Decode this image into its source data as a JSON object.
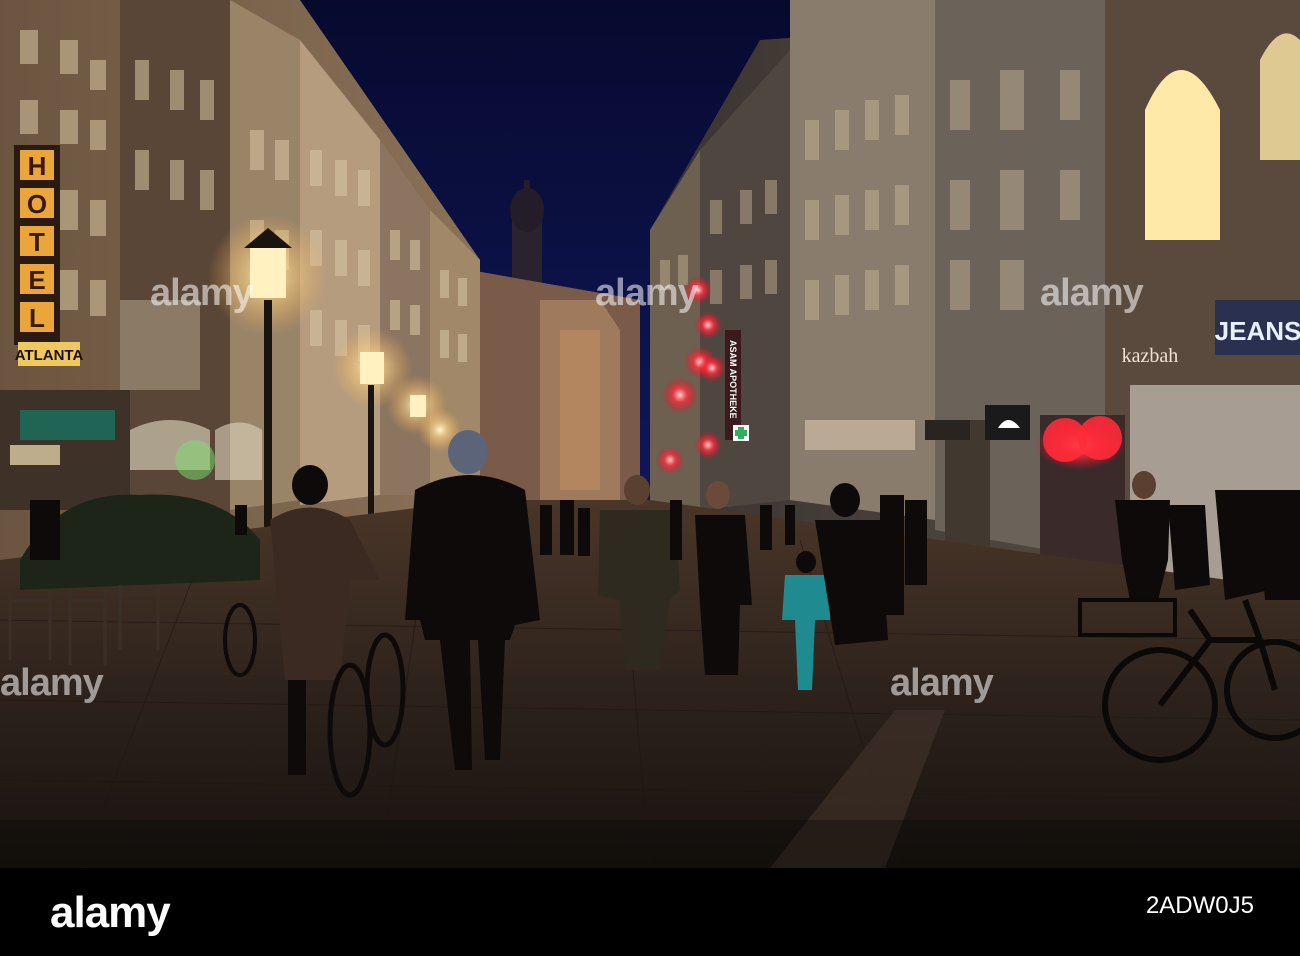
{
  "scene": {
    "description_icon": "night-street-photo",
    "signs": {
      "hotel_letters": [
        "H",
        "O",
        "T",
        "E",
        "L"
      ],
      "atlanta": "ATLANTA",
      "jeans": "JEANS",
      "kazbah": "kazbah",
      "apotheke": "ASAM APOTHEKE"
    }
  },
  "watermark": {
    "text": "alamy"
  },
  "footer": {
    "logo": "alamy",
    "image_id": "2ADW0J5"
  },
  "colors": {
    "sky": "#0a1240",
    "street": "#2a1f1a",
    "lamp": "#fff2c0"
  }
}
